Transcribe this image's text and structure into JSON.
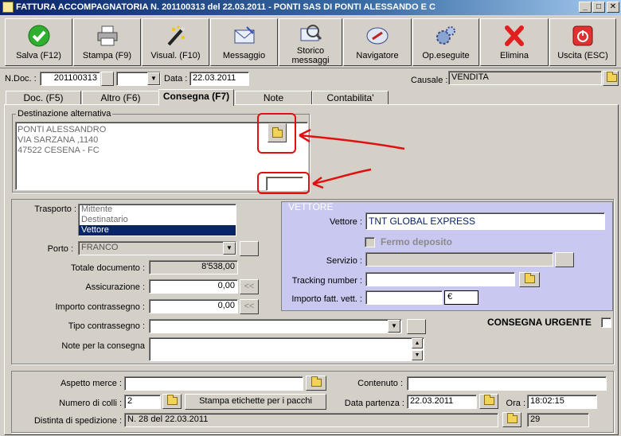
{
  "window": {
    "title": "FATTURA ACCOMPAGNATORIA N. 201100313  del 22.03.2011 - PONTI SAS DI PONTI ALESSANDO E C",
    "min": "_",
    "max": "□",
    "close": "✕"
  },
  "toolbar": {
    "buttons": [
      {
        "label": "Salva (F12)",
        "icon": "green-check-icon"
      },
      {
        "label": "Stampa (F9)",
        "icon": "printer-icon"
      },
      {
        "label": "Visual. (F10)",
        "icon": "magic-wand-icon"
      },
      {
        "label": "Messaggio",
        "icon": "envelope-icon"
      },
      {
        "label": "Storico messaggi",
        "line1": "Storico",
        "line2": "messaggi",
        "icon": "search-envelope-icon"
      },
      {
        "label": "Navigatore",
        "icon": "compass-icon"
      },
      {
        "label": "Op.eseguite",
        "icon": "gears-icon"
      },
      {
        "label": "Elimina",
        "icon": "red-x-icon"
      },
      {
        "label": "Uscita (ESC)",
        "icon": "power-icon"
      }
    ]
  },
  "header": {
    "ndoc_label": "N.Doc. :",
    "ndoc_value": "201100313",
    "data_label": "Data :",
    "data_value": "22.03.2011",
    "causale_label": "Causale :",
    "causale_value": "VENDITA"
  },
  "tabs": [
    {
      "label": "Doc. (F5)",
      "active": false
    },
    {
      "label": "Altro (F6)",
      "active": false
    },
    {
      "label": "Consegna (F7)",
      "active": true
    },
    {
      "label": "Note",
      "active": false
    },
    {
      "label": "Contabilita'",
      "active": false
    }
  ],
  "destinazione": {
    "group_title": "Destinazione alternativa",
    "lines": [
      "PONTI ALESSANDRO",
      "VIA SARZANA ,1140",
      "47522 CESENA  - FC"
    ],
    "code_value": ""
  },
  "trasporto": {
    "label": "Trasporto :",
    "options": [
      "Mittente",
      "Destinatario",
      "Vettore"
    ],
    "selected": "Vettore"
  },
  "porto": {
    "label": "Porto :",
    "value": "FRANCO"
  },
  "totale": {
    "label": "Totale documento :",
    "value": "8'538,00"
  },
  "assicurazione": {
    "label": "Assicurazione :",
    "value": "0,00"
  },
  "contrassegno": {
    "label": "Importo contrassegno :",
    "value": "0,00"
  },
  "tipo_contrassegno": {
    "label": "Tipo contrassegno :",
    "value": ""
  },
  "note_consegna": {
    "label": "Note per la consegna",
    "value": ""
  },
  "vettore": {
    "group_title": "VETTORE",
    "vettore_label": "Vettore :",
    "vettore_value": "TNT GLOBAL EXPRESS",
    "fermo_label": "Fermo deposito",
    "servizio_label": "Servizio :",
    "servizio_value": "",
    "tracking_label": "Tracking number :",
    "tracking_value": "",
    "importo_label": "Importo fatt. vett. :",
    "importo_value": "",
    "currency": "€"
  },
  "consegna_urgente": {
    "label": "CONSEGNA URGENTE"
  },
  "bottom": {
    "aspetto_label": "Aspetto merce :",
    "aspetto_value": "",
    "contenuto_label": "Contenuto :",
    "contenuto_value": "",
    "colli_label": "Numero di colli :",
    "colli_value": "2",
    "stampa_label": "Stampa etichette per i pacchi",
    "partenza_label": "Data partenza :",
    "partenza_value": "22.03.2011",
    "ora_label": "Ora :",
    "ora_value": "18:02:15",
    "distinta_label": "Distinta di spedizione :",
    "distinta_value": "N. 28 del 22.03.2011",
    "distinta_num": "29"
  },
  "colors": {
    "accent": "#0a246a",
    "annotation": "#e01010",
    "vettore_bg": "#c8c8f0"
  }
}
